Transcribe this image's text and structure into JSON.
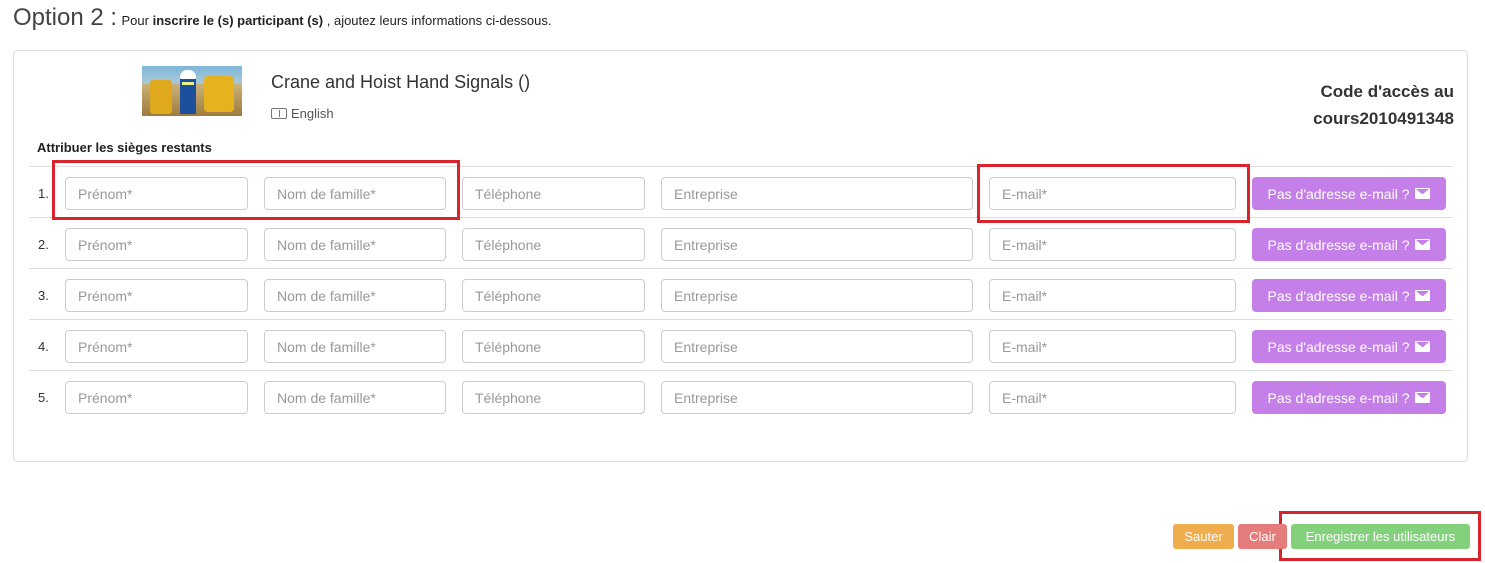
{
  "header": {
    "option": "Option 2 :",
    "text_prefix": "Pour",
    "text_bold": "inscrire le (s) participant (s)",
    "text_suffix": ", ajoutez leurs informations ci-dessous."
  },
  "course": {
    "title": "Crane and Hoist Hand Signals ()",
    "language": "English",
    "code_line1": "Code d'accès au",
    "code_line2": "cours2010491348"
  },
  "assign_label": "Attribuer les sièges restants",
  "placeholders": {
    "first_name": "Prénom*",
    "last_name": "Nom de famille*",
    "phone": "Téléphone",
    "company": "Entreprise",
    "email": "E-mail*"
  },
  "no_email_label": "Pas d'adresse e-mail ?",
  "rows": [
    {
      "num": "1."
    },
    {
      "num": "2."
    },
    {
      "num": "3."
    },
    {
      "num": "4."
    },
    {
      "num": "5."
    }
  ],
  "buttons": {
    "skip": "Sauter",
    "clear": "Clair",
    "save": "Enregistrer les utilisateurs"
  },
  "colors": {
    "no_email_button": "#c57fe9",
    "skip_button": "#f0ad4e",
    "clear_button": "#e57c7c",
    "save_button": "#84d17d",
    "highlight": "#d9232d"
  }
}
